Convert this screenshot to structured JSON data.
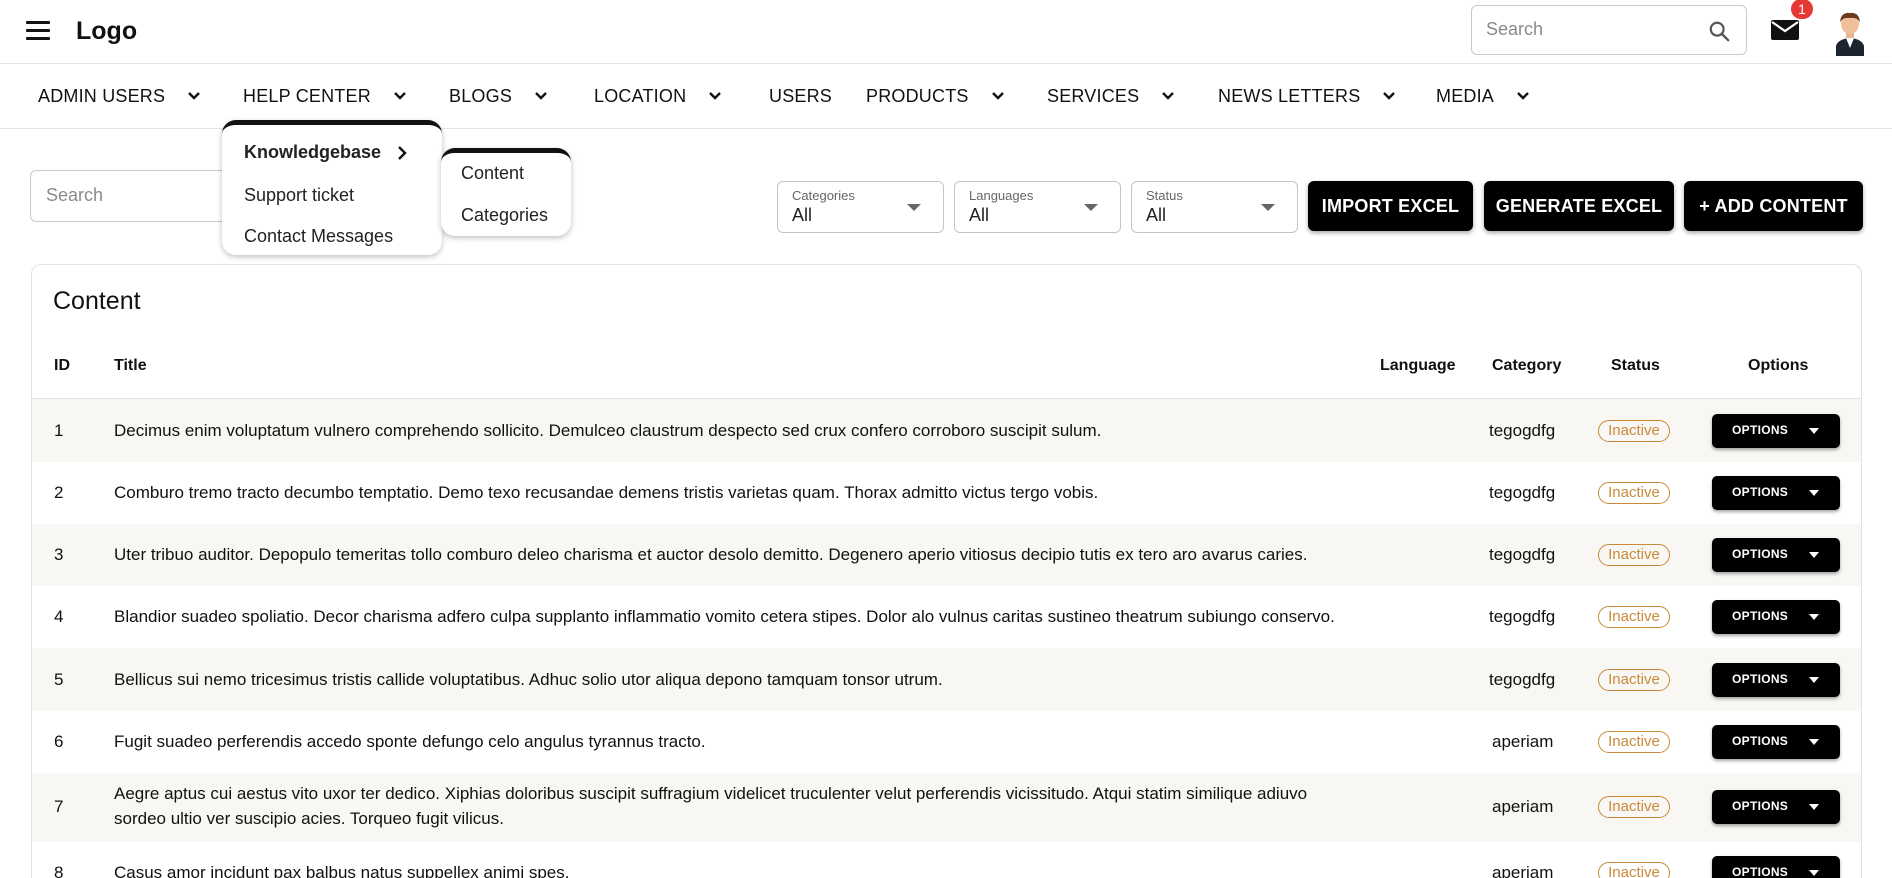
{
  "header": {
    "logo": "Logo",
    "search_placeholder": "Search",
    "notification_count": "1"
  },
  "nav": {
    "items": [
      {
        "label": "ADMIN USERS",
        "has_dropdown": true
      },
      {
        "label": "HELP CENTER",
        "has_dropdown": true
      },
      {
        "label": "BLOGS",
        "has_dropdown": true
      },
      {
        "label": "LOCATION",
        "has_dropdown": true
      },
      {
        "label": "USERS",
        "has_dropdown": false
      },
      {
        "label": "PRODUCTS",
        "has_dropdown": true
      },
      {
        "label": "SERVICES",
        "has_dropdown": true
      },
      {
        "label": "NEWS LETTERS",
        "has_dropdown": true
      },
      {
        "label": "MEDIA",
        "has_dropdown": true
      }
    ]
  },
  "help_center_menu": {
    "items": [
      "Knowledgebase",
      "Support ticket",
      "Contact Messages"
    ]
  },
  "knowledgebase_submenu": {
    "items": [
      "Content",
      "Categories"
    ]
  },
  "toolbar": {
    "search_placeholder": "Search",
    "filters": [
      {
        "label": "Categories",
        "value": "All"
      },
      {
        "label": "Languages",
        "value": "All"
      },
      {
        "label": "Status",
        "value": "All"
      }
    ],
    "import_label": "IMPORT EXCEL",
    "generate_label": "GENERATE EXCEL",
    "add_label": "+ ADD CONTENT"
  },
  "table": {
    "title": "Content",
    "columns": [
      "ID",
      "Title",
      "Language",
      "Category",
      "Status",
      "Options"
    ],
    "options_label": "OPTIONS",
    "rows": [
      {
        "id": "1",
        "title": "Decimus enim voluptatum vulnero comprehendo sollicito. Demulceo claustrum despecto sed crux confero corroboro suscipit sulum.",
        "language": "",
        "category": "tegogdfg",
        "status": "Inactive"
      },
      {
        "id": "2",
        "title": "Comburo tremo tracto decumbo temptatio. Demo texo recusandae demens tristis varietas quam. Thorax admitto victus tergo vobis.",
        "language": "",
        "category": "tegogdfg",
        "status": "Inactive"
      },
      {
        "id": "3",
        "title": "Uter tribuo auditor. Depopulo temeritas tollo comburo deleo charisma et auctor desolo demitto. Degenero aperio vitiosus decipio tutis ex tero aro avarus caries.",
        "language": "",
        "category": "tegogdfg",
        "status": "Inactive"
      },
      {
        "id": "4",
        "title": "Blandior suadeo spoliatio. Decor charisma adfero culpa supplanto inflammatio vomito cetera stipes. Dolor alo vulnus caritas sustineo theatrum subiungo conservo.",
        "language": "",
        "category": "tegogdfg",
        "status": "Inactive"
      },
      {
        "id": "5",
        "title": "Bellicus sui nemo tricesimus tristis callide voluptatibus. Adhuc solio utor aliqua depono tamquam tonsor utrum.",
        "language": "",
        "category": "tegogdfg",
        "status": "Inactive"
      },
      {
        "id": "6",
        "title": "Fugit suadeo perferendis accedo sponte defungo celo angulus tyrannus tracto.",
        "language": "",
        "category": "aperiam",
        "status": "Inactive"
      },
      {
        "id": "7",
        "title": "Aegre aptus cui aestus vito uxor ter dedico. Xiphias doloribus suscipit suffragium videlicet truculenter velut perferendis vicissitudo. Atqui statim similique adiuvo sordeo ultio ver suscipio acies. Torqueo fugit vilicus.",
        "language": "",
        "category": "aperiam",
        "status": "Inactive"
      },
      {
        "id": "8",
        "title": "Casus amor incidunt pax balbus natus suppellex animi spes.",
        "language": "",
        "category": "aperiam",
        "status": "Inactive"
      }
    ]
  },
  "colors": {
    "primary": "#000000",
    "status_inactive": "#c88a3a",
    "badge": "#e53935",
    "row_alt": "#f9f7f3"
  }
}
